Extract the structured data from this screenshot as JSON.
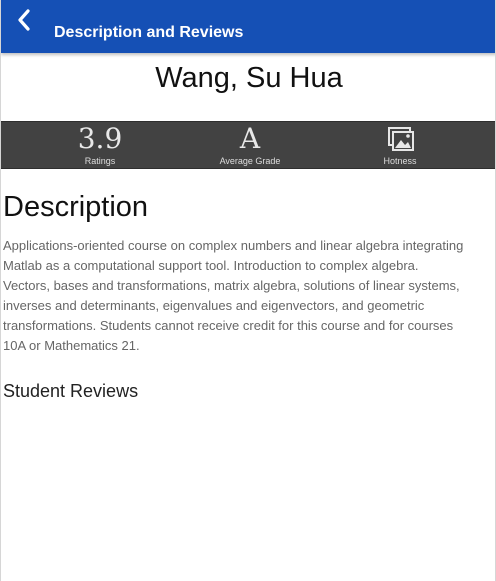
{
  "appbar": {
    "title": "Description and Reviews",
    "back_icon": "chevron-left-icon",
    "color": "#1550b5"
  },
  "professor": {
    "name": "Wang, Su Hua"
  },
  "stats": {
    "ratings": {
      "value": "3.9",
      "label": "Ratings"
    },
    "average_grade": {
      "value": "A",
      "label": "Average Grade"
    },
    "hotness": {
      "label": "Hotness",
      "icon": "photo-gallery-icon"
    }
  },
  "description": {
    "heading": "Description",
    "lines": [
      "Applications-oriented course on complex numbers and linear algebra integrating",
      "Matlab as a computational support tool. Introduction to complex algebra.",
      "Vectors, bases and transformations, matrix algebra, solutions of linear systems,",
      "inverses and determinants, eigenvalues and eigenvectors, and geometric",
      "transformations. Students cannot receive credit for this course and for courses",
      "10A or Mathematics 21."
    ]
  },
  "reviews": {
    "heading": "Student Reviews"
  }
}
